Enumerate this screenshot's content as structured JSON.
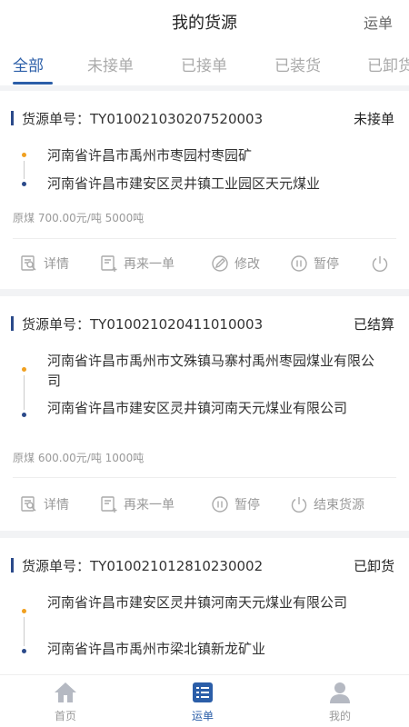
{
  "header": {
    "title": "我的货源",
    "right_link": "运单"
  },
  "tabs": [
    {
      "label": "全部",
      "active": true
    },
    {
      "label": "未接单"
    },
    {
      "label": "已接单"
    },
    {
      "label": "已装货"
    },
    {
      "label": "已卸货"
    }
  ],
  "order_label": "货源单号：",
  "cards": [
    {
      "order_no": "TY010021030207520003",
      "status": "未接单",
      "from": "河南省许昌市禹州市枣园村枣园矿",
      "to": "河南省许昌市建安区灵井镇工业园区天元煤业",
      "meta": "原煤  700.00元/吨  5000吨",
      "actions": [
        "详情",
        "再来一单",
        "修改",
        "暂停"
      ]
    },
    {
      "order_no": "TY010021020411010003",
      "status": "已结算",
      "from": "河南省许昌市禹州市文殊镇马寨村禹州枣园煤业有限公司",
      "to": "河南省许昌市建安区灵井镇河南天元煤业有限公司",
      "meta": "原煤  600.00元/吨  1000吨",
      "actions": [
        "详情",
        "再来一单",
        "暂停",
        "结束货源"
      ]
    },
    {
      "order_no": "TY010021012810230002",
      "status": "已卸货",
      "from": "河南省许昌市建安区灵井镇河南天元煤业有限公司",
      "to": "河南省许昌市禹州市梁北镇新龙矿业"
    }
  ],
  "tabbar": [
    {
      "label": "首页",
      "icon": "home-icon"
    },
    {
      "label": "运单",
      "icon": "list-icon",
      "active": true
    },
    {
      "label": "我的",
      "icon": "user-icon"
    }
  ],
  "colors": {
    "accent": "#2b5ea8",
    "origin_dot": "#f0a020",
    "dest_dot": "#2b4a8a"
  }
}
